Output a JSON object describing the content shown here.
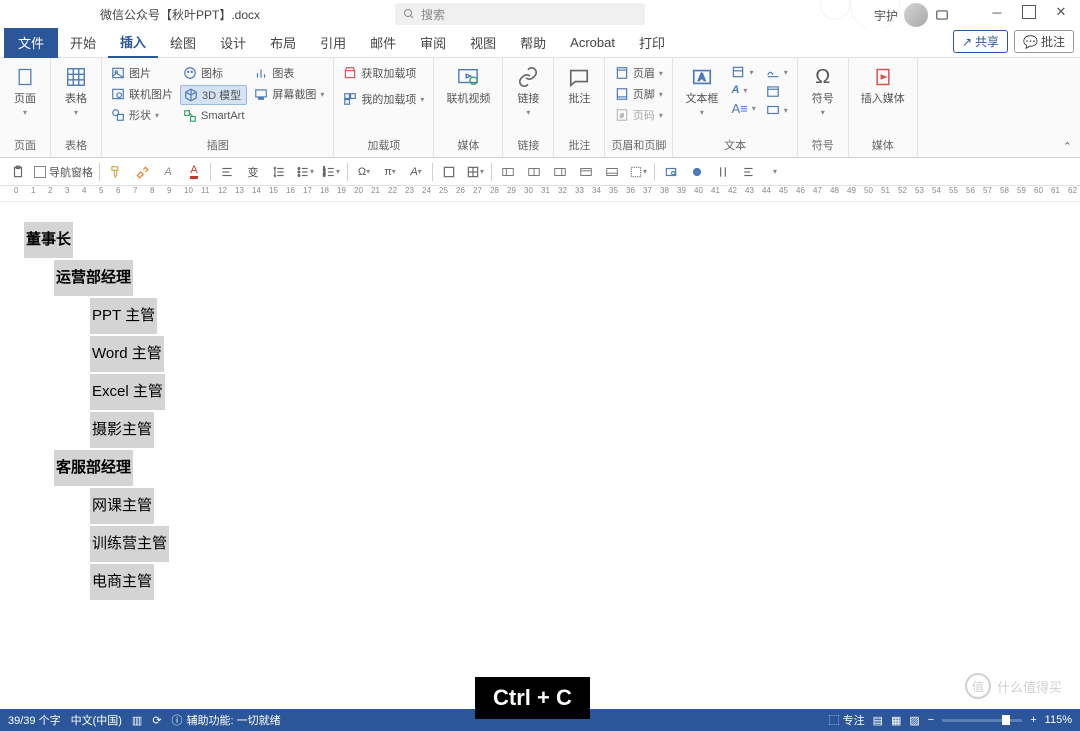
{
  "title": "微信公众号【秋叶PPT】.docx",
  "search_placeholder": "搜索",
  "user_name": "宇护",
  "file_tab": "文件",
  "tabs": [
    "开始",
    "插入",
    "绘图",
    "设计",
    "布局",
    "引用",
    "邮件",
    "审阅",
    "视图",
    "帮助",
    "Acrobat",
    "打印"
  ],
  "active_tab_index": 1,
  "share": "共享",
  "comments": "批注",
  "ribbon": {
    "page": {
      "label": "页面",
      "btn": "页面"
    },
    "table": {
      "label": "表格",
      "btn": "表格"
    },
    "illus": {
      "label": "插图",
      "pic": "图片",
      "online_pic": "联机图片",
      "shapes": "形状",
      "icons": "图标",
      "model3d": "3D 模型",
      "chart": "图表",
      "screenshot": "屏幕截图",
      "smartart": "SmartArt"
    },
    "addins": {
      "label": "加载项",
      "get": "获取加载项",
      "my": "我的加载项"
    },
    "media": {
      "label": "媒体",
      "video": "联机视频"
    },
    "links": {
      "label": "链接",
      "link": "链接"
    },
    "comments_grp": {
      "label": "批注",
      "btn": "批注"
    },
    "headerfooter": {
      "label": "页眉和页脚",
      "header": "页眉",
      "footer": "页脚",
      "pagenum": "页码"
    },
    "text": {
      "label": "文本",
      "textbox": "文本框"
    },
    "symbols": {
      "label": "符号",
      "symbol": "符号"
    },
    "insert_media": {
      "label": "媒体",
      "btn": "插入媒体"
    }
  },
  "qat_nav": "导航窗格",
  "document": {
    "l1": "董事长",
    "l2a": "运营部经理",
    "l3a": "PPT 主管",
    "l3b": "Word 主管",
    "l3c": "Excel 主管",
    "l3d": "摄影主管",
    "l2b": "客服部经理",
    "l3e": "网课主管",
    "l3f": "训练营主管",
    "l3g": "电商主管"
  },
  "status": {
    "words": "39/39 个字",
    "lang": "中文(中国)",
    "access": "辅助功能: 一切就绪",
    "focus": "专注",
    "zoom": "115%"
  },
  "overlay": "Ctrl + C",
  "watermark": "什么值得买"
}
